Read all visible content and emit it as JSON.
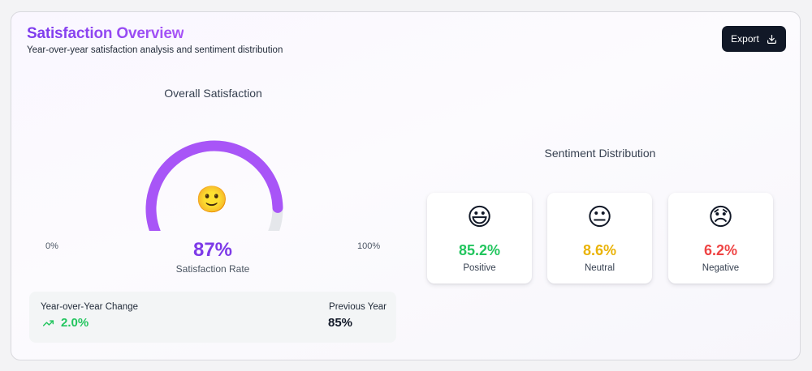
{
  "header": {
    "title": "Satisfaction Overview",
    "subtitle": "Year-over-year satisfaction analysis and sentiment distribution",
    "export_label": "Export",
    "export_icon": "download-icon"
  },
  "gauge": {
    "heading": "Overall Satisfaction",
    "emoji": "🙂",
    "min_label": "0%",
    "max_label": "100%",
    "value": 87,
    "value_label": "87%",
    "caption": "Satisfaction Rate",
    "fill_color": "#a855f7",
    "track_color": "#e5e7eb"
  },
  "yoy": {
    "label": "Year-over-Year Change",
    "change": "2.0%",
    "trend_icon": "trending-up-icon",
    "trend_color": "#22c55e",
    "previous_label": "Previous Year",
    "previous_value": "85%"
  },
  "sentiment": {
    "heading": "Sentiment Distribution",
    "items": [
      {
        "emoji": "😃",
        "value": "85.2%",
        "label": "Positive",
        "color": "#22c55e"
      },
      {
        "emoji": "😐",
        "value": "8.6%",
        "label": "Neutral",
        "color": "#eab308"
      },
      {
        "emoji": "😞",
        "value": "6.2%",
        "label": "Negative",
        "color": "#ef4444"
      }
    ]
  }
}
